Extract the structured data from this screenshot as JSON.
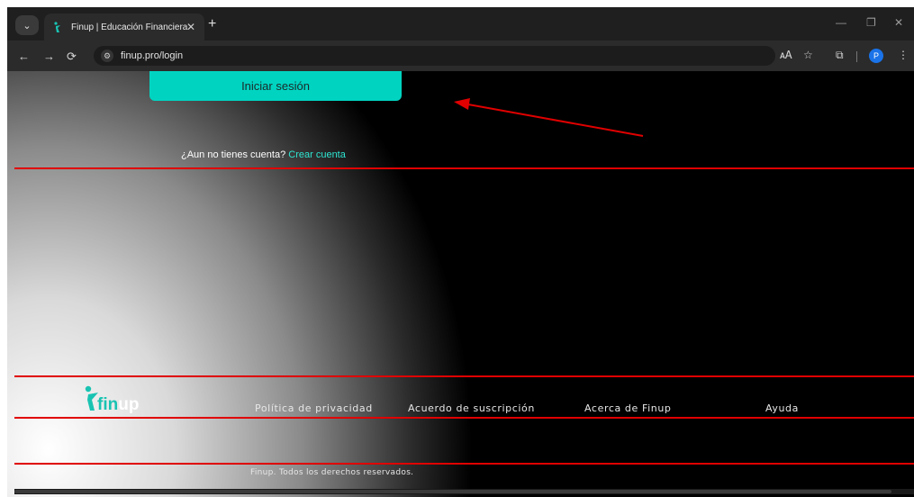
{
  "browser": {
    "tab_title": "Finup | Educación Financiera",
    "url": "finup.pro/login",
    "profile_initial": "P",
    "icons": [
      "tab-menu-icon",
      "finup-favicon",
      "close-icon",
      "plus-icon",
      "minimize-icon",
      "restore-icon",
      "close-window-icon",
      "back-arrow-icon",
      "forward-arrow-icon",
      "reload-icon",
      "site-settings-icon",
      "translate-icon",
      "star-icon",
      "extensions-icon",
      "kebab-menu-icon"
    ]
  },
  "page": {
    "login_button": "Iniciar sesión",
    "signup_prompt": "¿Aun no tienes cuenta?",
    "signup_link": "Crear cuenta",
    "logo": {
      "part1": "fin",
      "part2": "up"
    },
    "footer_links": [
      "Política de privacidad",
      "Acuerdo de suscripción",
      "Acerca de Finup",
      "Ayuda"
    ],
    "copyright": "Finup. Todos los derechos reservados."
  },
  "annotations": {
    "color": "#e00000"
  }
}
